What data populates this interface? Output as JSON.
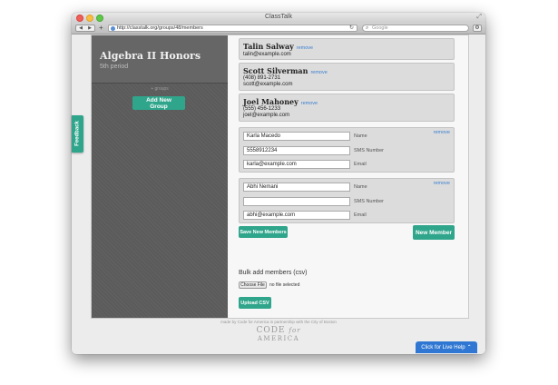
{
  "window": {
    "title": "ClassTalk"
  },
  "toolbar": {
    "url": "http://classtalk.org/groups/48/members",
    "search_placeholder": "Google"
  },
  "sidebar": {
    "group_title": "Algebra II Honors",
    "group_subtitle": "5th period",
    "caption": "+ groups",
    "add_group_label": "Add New Group"
  },
  "members": [
    {
      "name": "Talin Salway",
      "remove_label": "remove",
      "phone": "",
      "email": "talin@example.com"
    },
    {
      "name": "Scott Silverman",
      "remove_label": "remove",
      "phone": "(408) 891-2731",
      "email": "scott@example.com"
    },
    {
      "name": "Joel Mahoney",
      "remove_label": "remove",
      "phone": "(555) 456-1233",
      "email": "joel@example.com"
    }
  ],
  "new_members": [
    {
      "name": "Karla Macedo",
      "sms": "5558912234",
      "email": "karla@example.com",
      "remove_label": "remove"
    },
    {
      "name": "Abhi Nemani",
      "sms": "",
      "email": "abhi@example.com",
      "remove_label": "remove"
    }
  ],
  "field_labels": {
    "name": "Name",
    "sms": "SMS Number",
    "email": "Email"
  },
  "actions": {
    "save_label": "Save New Members",
    "new_member_label": "New Member",
    "bulk_label": "Bulk add members (csv)",
    "choose_file_label": "Choose File",
    "no_file_label": "no file selected",
    "upload_label": "Upload CSV"
  },
  "footer": {
    "credit": "made by Code for America in partnership with the City of Boston",
    "logo_line1_a": "CODE",
    "logo_line1_b": "for",
    "logo_line2": "AMERICA"
  },
  "feedback_label": "Feedback",
  "live_help_label": "Click for Live Help",
  "colors": {
    "accent": "#2fa58b",
    "sidebar": "#5b5b5b",
    "link": "#3a7fd0",
    "live_help": "#2f77d2"
  }
}
